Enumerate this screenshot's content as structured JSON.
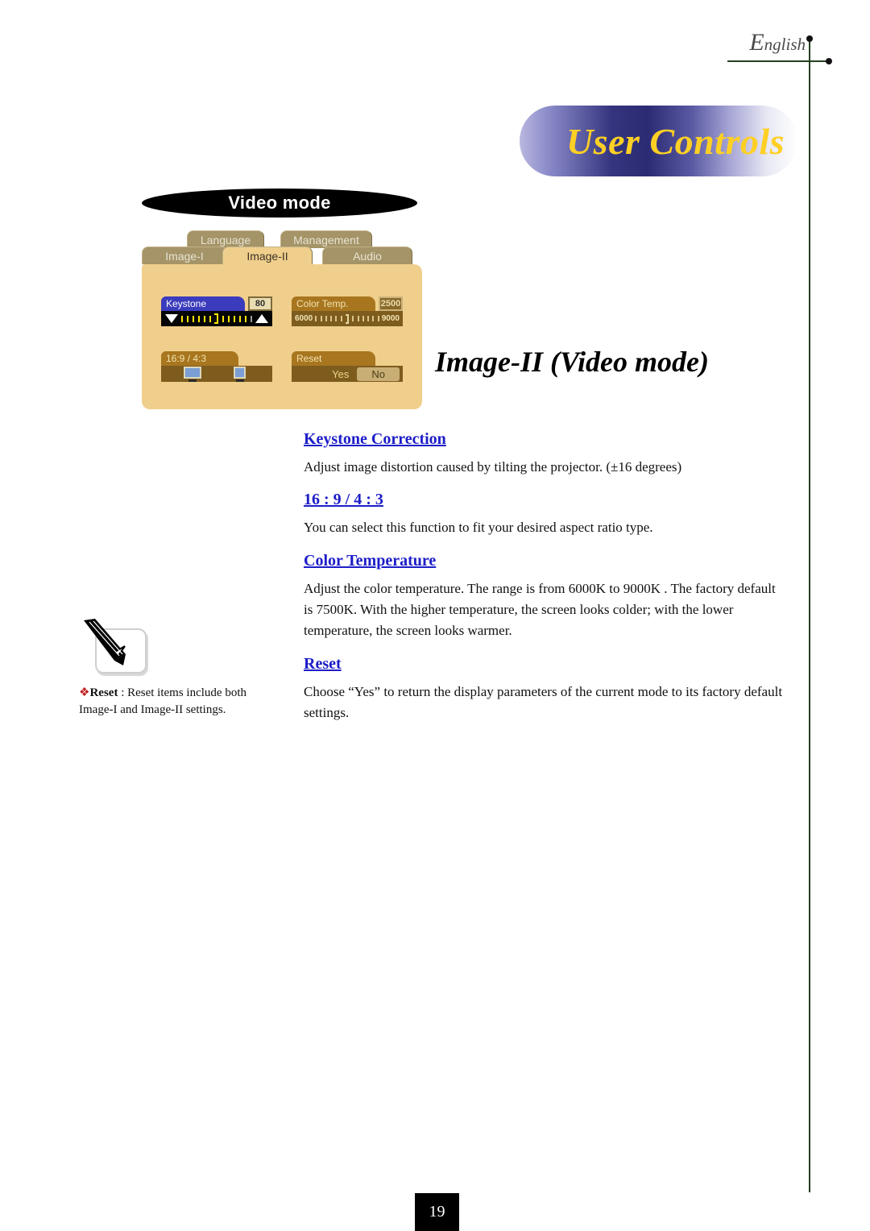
{
  "header": {
    "language_label_big": "E",
    "language_label_small": "nglish",
    "chapter_banner": "User Controls"
  },
  "osd": {
    "mode_banner": "Video mode",
    "tabs_top": [
      {
        "label": "Language",
        "active": false
      },
      {
        "label": "Management",
        "active": false
      }
    ],
    "tabs_bottom": [
      {
        "label": "Image-I",
        "active": false
      },
      {
        "label": "Image-II",
        "active": true
      },
      {
        "label": "Audio",
        "active": false
      }
    ],
    "items": {
      "keystone": {
        "title": "Keystone",
        "value": "80"
      },
      "color_temp": {
        "title": "Color Temp.",
        "value": "2500",
        "range_min": "6000",
        "range_max": "9000"
      },
      "aspect": {
        "title": "16:9 / 4:3",
        "icon_wide": "monitor-16-9-icon",
        "icon_standard": "monitor-4-3-icon"
      },
      "reset": {
        "title": "Reset",
        "yes_label": "Yes",
        "no_label": "No",
        "selected": "No"
      }
    }
  },
  "page": {
    "title": "Image-II (Video mode)",
    "number": "19"
  },
  "sections": [
    {
      "heading": "Keystone Correction",
      "body": "Adjust image distortion caused by tilting the projector. (±16 degrees)"
    },
    {
      "heading": "16 : 9 / 4 : 3",
      "body": "You can select this function to fit your desired aspect ratio type."
    },
    {
      "heading": "Color Temperature",
      "body": "Adjust the color temperature. The range is from 6000K to 9000K . The factory default is 7500K.  With the higher temperature, the screen looks colder; with the lower temperature, the screen looks warmer."
    },
    {
      "heading": "Reset",
      "body": "Choose “Yes” to return the display parameters of the current mode to its factory default settings."
    }
  ],
  "note": {
    "icon": "pencil-note-icon",
    "bullet": "❖",
    "term": "Reset",
    "separator": " : ",
    "text": "Reset items include both Image-I and Image-II settings."
  },
  "colors": {
    "heading_blue": "#1d1dc8",
    "banner_gold": "#ffd024",
    "osd_panel": "#f0cf8c",
    "osd_tab": "#a59467",
    "osd_bar_brown": "#7e5c1e",
    "keystone_header_blue": "#3b3bbd",
    "margin_rule_green": "#24401f",
    "bullet_red": "#c21f1f"
  }
}
